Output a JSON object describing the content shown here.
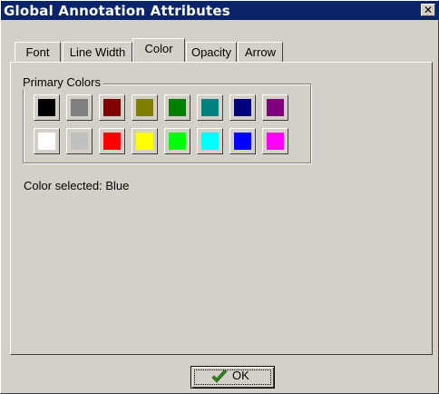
{
  "window": {
    "title": "Global Annotation Attributes",
    "close_glyph": "✕"
  },
  "tabs": [
    {
      "label": "Font",
      "active": false
    },
    {
      "label": "Line Width",
      "active": false
    },
    {
      "label": "Color",
      "active": true
    },
    {
      "label": "Opacity",
      "active": false
    },
    {
      "label": "Arrow",
      "active": false
    }
  ],
  "primary_colors": {
    "label": "Primary Colors",
    "swatches": [
      {
        "name": "Black",
        "color": "#000000"
      },
      {
        "name": "Gray",
        "color": "#808080"
      },
      {
        "name": "Maroon",
        "color": "#800000"
      },
      {
        "name": "Olive",
        "color": "#808000"
      },
      {
        "name": "Green",
        "color": "#008000"
      },
      {
        "name": "Teal",
        "color": "#008080"
      },
      {
        "name": "Navy",
        "color": "#000080"
      },
      {
        "name": "Purple",
        "color": "#800080"
      },
      {
        "name": "White",
        "color": "#ffffff"
      },
      {
        "name": "Silver",
        "color": "#c0c0c0"
      },
      {
        "name": "Red",
        "color": "#ff0000"
      },
      {
        "name": "Yellow",
        "color": "#ffff00"
      },
      {
        "name": "Lime",
        "color": "#00ff00"
      },
      {
        "name": "Aqua",
        "color": "#00ffff"
      },
      {
        "name": "Blue",
        "color": "#0000ff"
      },
      {
        "name": "Fuchsia",
        "color": "#ff00ff"
      }
    ]
  },
  "status": {
    "text": "Color selected: Blue"
  },
  "ok_button": {
    "label": "OK",
    "icon": "checkmark-icon",
    "icon_color": "#2e8b1e"
  }
}
